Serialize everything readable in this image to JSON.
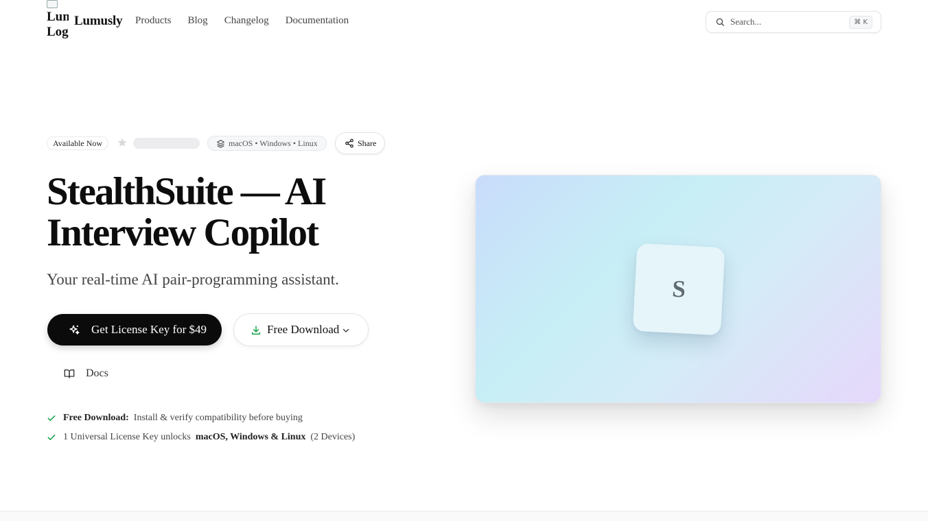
{
  "header": {
    "logo_alt": "Lumusly Logo",
    "brand": "Lumusly",
    "nav": [
      "Products",
      "Blog",
      "Changelog",
      "Documentation"
    ],
    "search": {
      "placeholder": "Search...",
      "shortcut": "⌘ K"
    }
  },
  "hero": {
    "badges": {
      "available": "Available Now",
      "platforms": "macOS • Windows • Linux",
      "share": "Share"
    },
    "title": "StealthSuite — AI Interview Copilot",
    "subtitle": "Your real-time AI pair-programming assistant.",
    "primary_button": "Get License Key for $49",
    "secondary_button": "Free Download",
    "docs_link": "Docs",
    "features": [
      {
        "bold": "Free Download:",
        "text": "Install & verify compatibility before buying"
      },
      {
        "prefix": "1 Universal License Key unlocks",
        "bold": "macOS, Windows & Linux",
        "suffix": "(2 Devices)"
      }
    ]
  },
  "visual": {
    "app_icon_letter": "S"
  },
  "icons": {
    "search": "search-icon",
    "star": "star-icon",
    "layers": "layers-icon",
    "share": "share-icon",
    "sparkle": "sparkle-icon",
    "download": "download-icon",
    "chevron": "chevron-down-icon",
    "book": "book-icon",
    "check": "check-icon"
  },
  "colors": {
    "primary_button_bg": "#0b0b0c",
    "check": "#16a34a",
    "download_icon": "#16a34a",
    "gradient": [
      "#c9dcfb",
      "#c7eef6",
      "#e6d8fb"
    ]
  }
}
